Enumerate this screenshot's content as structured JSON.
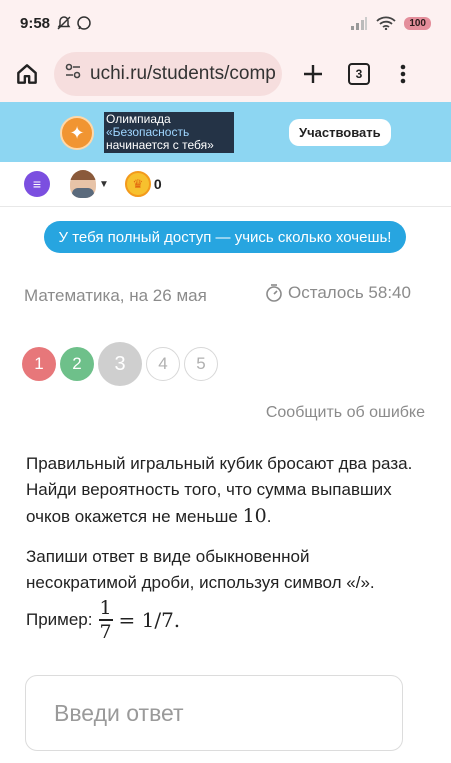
{
  "status_bar": {
    "time": "9:58",
    "battery": "100"
  },
  "browser": {
    "url": "uchi.ru/students/comp",
    "tab_count": "3"
  },
  "banner": {
    "title_line1": "Олимпиада",
    "title_line2": "«Безопасность",
    "title_line3": "начинается с тебя»",
    "cta": "Участвовать"
  },
  "toolbar": {
    "coins": "0"
  },
  "access_pill": "У тебя полный доступ — учись сколько хочешь!",
  "lesson": {
    "subject": "Математика, на 26 мая",
    "timer": "Осталось 58:40"
  },
  "steps": [
    {
      "label": "1",
      "state": "wrong"
    },
    {
      "label": "2",
      "state": "right"
    },
    {
      "label": "3",
      "state": "current"
    },
    {
      "label": "4",
      "state": "todo"
    },
    {
      "label": "5",
      "state": "todo"
    }
  ],
  "report_link": "Сообщить об ошибке",
  "task": {
    "line1": "Правильный игральный кубик бросают два раза.",
    "line2": "Найди вероятность того, что сумма выпавших",
    "line3_text": "очков окажется не меньше ",
    "line3_math": "10",
    "line3_end": ".",
    "instr_line1": "Запиши ответ в виде обыкновенной",
    "instr_line2": "несократимой дроби, используя символ «/».",
    "example_label": "Пример:",
    "example_num": "1",
    "example_den": "7",
    "example_rhs": "= 1/7."
  },
  "answer": {
    "placeholder": "Введи ответ"
  },
  "colors": {
    "banner_bg": "#8dd6f2",
    "access_pill": "#27a5e0",
    "step_wrong": "#e7777a",
    "step_right": "#6ec08a",
    "step_current": "#cfcfcf"
  }
}
